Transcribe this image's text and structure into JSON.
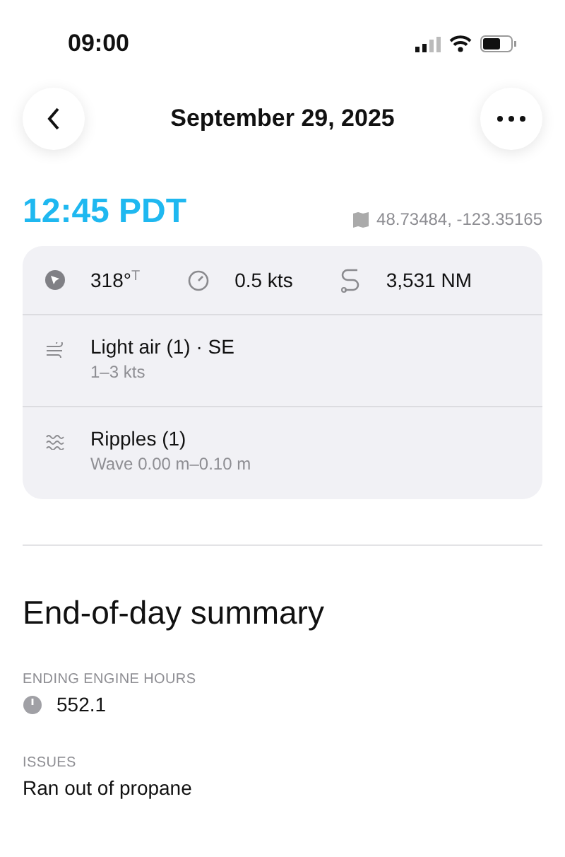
{
  "status_bar": {
    "time": "09:00"
  },
  "header": {
    "title": "September 29, 2025"
  },
  "entry": {
    "time": "12:45 PDT",
    "coordinates": "48.73484, -123.35165"
  },
  "stats": [
    {
      "kind": "heading",
      "value": "318°",
      "unit": "T"
    },
    {
      "kind": "speed",
      "value": "0.5 kts"
    },
    {
      "kind": "distance",
      "value": "3,531 NM"
    }
  ],
  "conditions": [
    {
      "kind": "wind",
      "title": "Light air (1) · SE",
      "detail": "1–3 kts"
    },
    {
      "kind": "waves",
      "title": "Ripples (1)",
      "detail": "Wave 0.00 m–0.10 m"
    }
  ],
  "summary": {
    "title": "End-of-day summary",
    "fields": [
      {
        "kind": "engine",
        "label": "ENDING ENGINE HOURS",
        "value": "552.1"
      },
      {
        "kind": "text",
        "label": "ISSUES",
        "value": "Ran out of propane"
      }
    ]
  }
}
